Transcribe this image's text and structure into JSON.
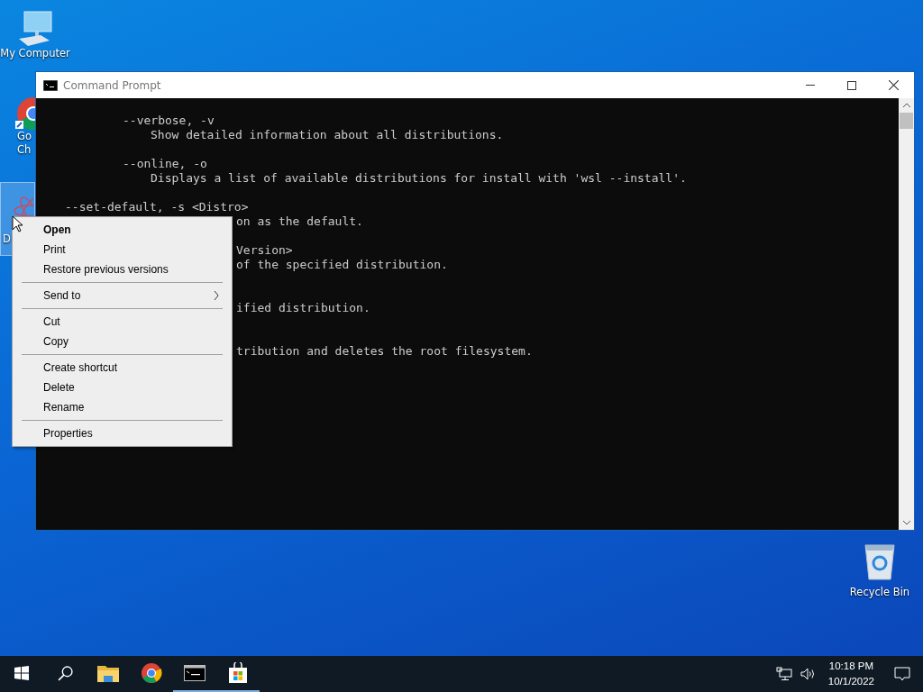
{
  "desktop_icons": [
    {
      "kind": "computer",
      "lines": [
        "My Computer"
      ],
      "selected": false
    },
    {
      "kind": "chrome",
      "lines": [
        "Go",
        "Ch"
      ],
      "selected": false
    },
    {
      "kind": "app",
      "lines": [
        "D"
      ],
      "selected": true
    }
  ],
  "recycle_bin": {
    "label": "Recycle Bin"
  },
  "window": {
    "title": "Command Prompt",
    "lines": [
      {
        "kind": "option",
        "text": "--verbose, -v"
      },
      {
        "kind": "description",
        "text": "Show detailed information about all distributions."
      },
      {
        "kind": "blank"
      },
      {
        "kind": "option",
        "text": "--online, -o"
      },
      {
        "kind": "description",
        "text": "Displays a list of available distributions for install with 'wsl --install'."
      },
      {
        "kind": "blank"
      },
      {
        "kind": "command",
        "text": "--set-default, -s <Distro>"
      },
      {
        "kind": "partial",
        "text": "on as the default."
      },
      {
        "kind": "blank"
      },
      {
        "kind": "partial",
        "text": "Version>"
      },
      {
        "kind": "partial",
        "text": "of the specified distribution."
      },
      {
        "kind": "blank"
      },
      {
        "kind": "blank"
      },
      {
        "kind": "partial",
        "text": "ified distribution."
      },
      {
        "kind": "blank"
      },
      {
        "kind": "blank"
      },
      {
        "kind": "partial",
        "text": "tribution and deletes the root filesystem."
      }
    ]
  },
  "context_menu": [
    {
      "kind": "item",
      "label": "Open",
      "default": true,
      "submenu": false
    },
    {
      "kind": "item",
      "label": "Print",
      "default": false,
      "submenu": false
    },
    {
      "kind": "item",
      "label": "Restore previous versions",
      "default": false,
      "submenu": false
    },
    {
      "kind": "separator"
    },
    {
      "kind": "item",
      "label": "Send to",
      "default": false,
      "submenu": true
    },
    {
      "kind": "separator"
    },
    {
      "kind": "item",
      "label": "Cut",
      "default": false,
      "submenu": false
    },
    {
      "kind": "item",
      "label": "Copy",
      "default": false,
      "submenu": false
    },
    {
      "kind": "separator"
    },
    {
      "kind": "item",
      "label": "Create shortcut",
      "default": false,
      "submenu": false
    },
    {
      "kind": "item",
      "label": "Delete",
      "default": false,
      "submenu": false
    },
    {
      "kind": "item",
      "label": "Rename",
      "default": false,
      "submenu": false
    },
    {
      "kind": "separator"
    },
    {
      "kind": "item",
      "label": "Properties",
      "default": false,
      "submenu": false
    }
  ],
  "taskbar": {
    "apps": [
      {
        "kind": "explorer",
        "running": false
      },
      {
        "kind": "chrome",
        "running": false
      },
      {
        "kind": "terminal",
        "running": true
      },
      {
        "kind": "store",
        "running": true
      }
    ],
    "clock": {
      "time": "10:18 PM",
      "date": "10/1/2022"
    }
  }
}
